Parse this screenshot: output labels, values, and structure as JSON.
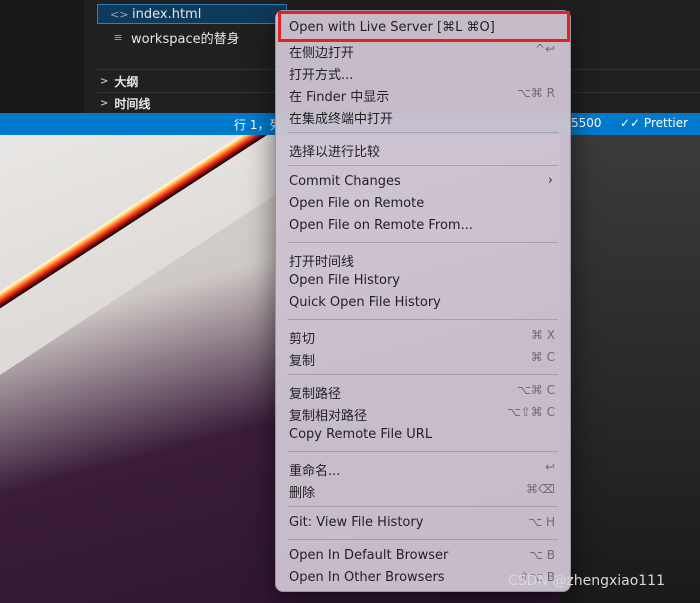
{
  "explorer": {
    "files": [
      {
        "icon": "<>",
        "name": "index.html"
      },
      {
        "icon": "≡",
        "name": "workspace的替身"
      }
    ],
    "sections": [
      "大纲",
      "时间线"
    ]
  },
  "statusbar": {
    "left_text": "行 1，列",
    "port_text": "5500",
    "prettier": "✓✓ Prettier"
  },
  "menu": {
    "items": [
      {
        "label": "Open with Live Server [⌘L ⌘O]",
        "shortcut": ""
      },
      {
        "label": "在侧边打开",
        "shortcut": "^↩"
      },
      {
        "label": "打开方式...",
        "shortcut": ""
      },
      {
        "label": "在 Finder 中显示",
        "shortcut": "⌥⌘ R"
      },
      {
        "label": "在集成终端中打开",
        "shortcut": ""
      },
      {
        "label": "选择以进行比较",
        "shortcut": ""
      },
      {
        "label": "Commit Changes",
        "shortcut": ""
      },
      {
        "label": "Open File on Remote",
        "shortcut": ""
      },
      {
        "label": "Open File on Remote From...",
        "shortcut": ""
      },
      {
        "label": "打开时间线",
        "shortcut": ""
      },
      {
        "label": "Open File History",
        "shortcut": ""
      },
      {
        "label": "Quick Open File History",
        "shortcut": ""
      },
      {
        "label": "剪切",
        "shortcut": "⌘ X"
      },
      {
        "label": "复制",
        "shortcut": "⌘ C"
      },
      {
        "label": "复制路径",
        "shortcut": "⌥⌘ C"
      },
      {
        "label": "复制相对路径",
        "shortcut": "⌥⇧⌘ C"
      },
      {
        "label": "Copy Remote File URL",
        "shortcut": ""
      },
      {
        "label": "重命名...",
        "shortcut": "↩"
      },
      {
        "label": "删除",
        "shortcut": "⌘⌫"
      },
      {
        "label": "Git: View File History",
        "shortcut": "⌥ H"
      },
      {
        "label": "Open In Default Browser",
        "shortcut": "⌥ B"
      },
      {
        "label": "Open In Other Browsers",
        "shortcut": "⇧⌥ B"
      }
    ],
    "submenu_arrow": "›"
  },
  "watermark": "CSDN @zhengxiao111",
  "colors": {
    "statusbar": "#007acc",
    "highlight_box": "#e02424"
  }
}
